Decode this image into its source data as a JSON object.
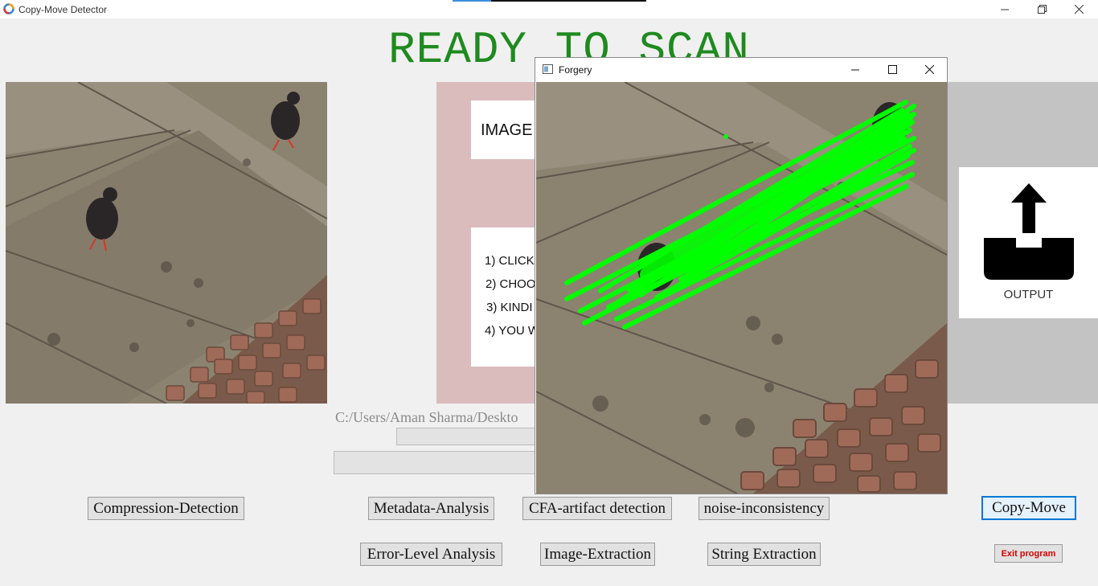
{
  "window": {
    "title": "Copy-Move Detector",
    "controls": [
      "minimize",
      "restore",
      "close"
    ]
  },
  "heading": "READY TO SCAN",
  "instructions": {
    "card_title": "IMAGE",
    "steps": [
      "1) CLICK",
      "2) CHOO",
      "3) KINDI",
      "4) YOU W"
    ]
  },
  "output_label": "OUTPUT",
  "file_path": "C:/Users/Aman Sharma/Deskto",
  "buttons": {
    "compression_detection": "Compression-Detection",
    "metadata_analysis": "Metadata-Analysis",
    "cfa_artifact_detection": "CFA-artifact detection",
    "noise_inconsistency": "noise-inconsistency",
    "copy_move": "Copy-Move",
    "error_level_analysis": "Error-Level Analysis",
    "image_extraction": "Image-Extraction",
    "string_extraction": "String Extraction",
    "exit_program": "Exit program"
  },
  "forgery_window": {
    "title": "Forgery",
    "controls": [
      "minimize",
      "maximize",
      "close"
    ]
  },
  "colors": {
    "heading": "#1f8a1f",
    "match_lines": "#00ff00",
    "panel_pink": "#dbbcbd",
    "panel_gray": "#c3c3c3",
    "exit_text": "#d40000",
    "active_border": "#0078d7"
  },
  "icons": [
    "app-logo-icon",
    "upload-tray-icon",
    "window-icon"
  ]
}
